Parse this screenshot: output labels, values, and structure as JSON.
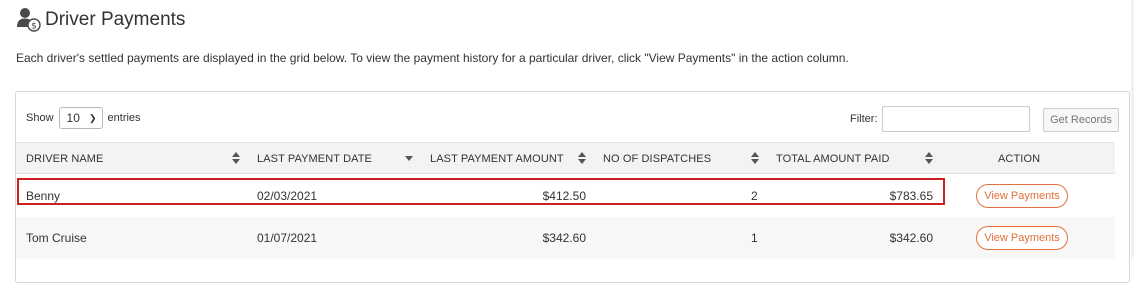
{
  "header": {
    "title": "Driver Payments",
    "icon": "driver-payment-icon"
  },
  "description": "Each driver's settled payments are displayed in the grid below. To view the payment history for a particular driver, click \"View Payments\" in the action column.",
  "controls": {
    "show_label": "Show",
    "entries_value": "10",
    "entries_label": "entries",
    "filter_label": "Filter:",
    "filter_value": "",
    "get_records_label": "Get Records"
  },
  "table": {
    "columns": [
      {
        "label": "DRIVER NAME",
        "sort": "both"
      },
      {
        "label": "LAST PAYMENT DATE",
        "sort": "desc"
      },
      {
        "label": "LAST PAYMENT AMOUNT",
        "sort": "both"
      },
      {
        "label": "NO OF DISPATCHES",
        "sort": "both"
      },
      {
        "label": "TOTAL AMOUNT PAID",
        "sort": "both"
      },
      {
        "label": "ACTION",
        "sort": "none"
      }
    ],
    "rows": [
      {
        "driver_name": "Benny",
        "last_payment_date": "02/03/2021",
        "last_payment_amount": "$412.50",
        "dispatches": "2",
        "total_paid": "$783.65",
        "action": "View Payments",
        "highlighted": true
      },
      {
        "driver_name": "Tom Cruise",
        "last_payment_date": "01/07/2021",
        "last_payment_amount": "$342.60",
        "dispatches": "1",
        "total_paid": "$342.60",
        "action": "View Payments",
        "highlighted": false
      }
    ]
  },
  "colors": {
    "accent": "#e2703c",
    "highlight_border": "#cc1f1f",
    "header_bg": "#f3f3f3"
  }
}
